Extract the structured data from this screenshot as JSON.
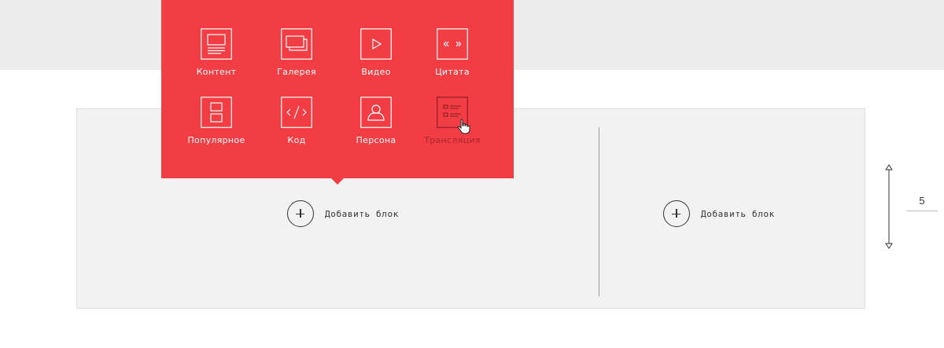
{
  "menu": {
    "items": [
      {
        "label": "Контент",
        "icon": "content-icon"
      },
      {
        "label": "Галерея",
        "icon": "gallery-icon"
      },
      {
        "label": "Видео",
        "icon": "video-icon"
      },
      {
        "label": "Цитата",
        "icon": "quote-icon"
      },
      {
        "label": "Популярное",
        "icon": "popular-icon"
      },
      {
        "label": "Код",
        "icon": "code-icon"
      },
      {
        "label": "Персона",
        "icon": "person-icon"
      },
      {
        "label": "Трансляция",
        "icon": "broadcast-icon"
      }
    ],
    "hovered_item": "Трансляция",
    "background": "#f33d45"
  },
  "columns": {
    "left": {
      "add_label": "Добавить блок"
    },
    "right": {
      "add_label": "Добавить блок"
    }
  },
  "spacing": {
    "value": "5"
  }
}
